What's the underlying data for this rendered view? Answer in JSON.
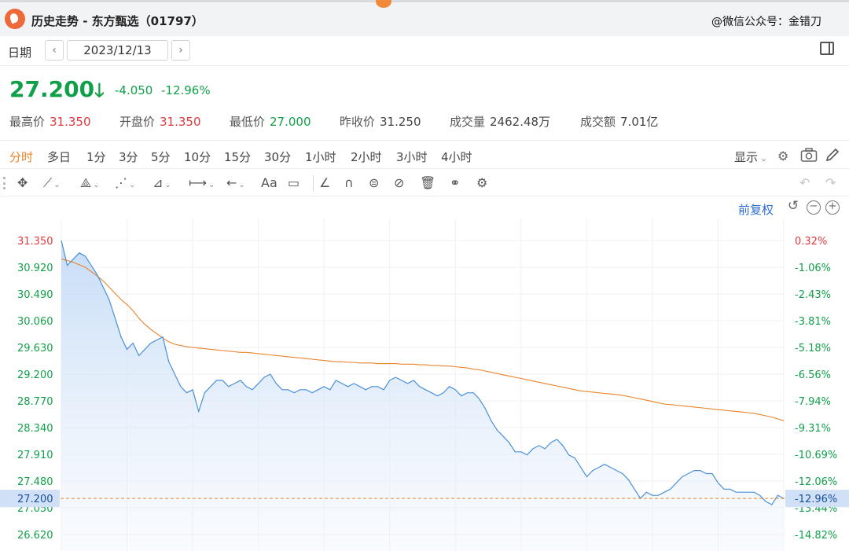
{
  "window": {
    "title": "历史走势 - 东方甄选（01797）",
    "watermark": "@微信公众号：金错刀"
  },
  "date_bar": {
    "label": "日期",
    "prev": "‹",
    "next": "›",
    "date": "2023/12/13"
  },
  "quote": {
    "price": "27.200",
    "arrow": "🡓",
    "change": "-4.050",
    "change_pct": "-12.96%",
    "stats": [
      {
        "label": "最高价",
        "value": "31.350",
        "tone": "up"
      },
      {
        "label": "开盘价",
        "value": "31.350",
        "tone": "up"
      },
      {
        "label": "最低价",
        "value": "27.000",
        "tone": "down"
      },
      {
        "label": "昨收价",
        "value": "31.250",
        "tone": "neutral"
      },
      {
        "label": "成交量",
        "value": "2462.48万",
        "tone": "neutral"
      },
      {
        "label": "成交额",
        "value": "7.01亿",
        "tone": "neutral"
      }
    ]
  },
  "periods": {
    "tabs": [
      "分时",
      "多日",
      "1分",
      "3分",
      "5分",
      "10分",
      "15分",
      "30分",
      "1小时",
      "2小时",
      "3小时",
      "4小时"
    ],
    "active": "分时",
    "show_label": "显示"
  },
  "chart_header": {
    "restore_label": "前复权"
  },
  "colors": {
    "up": "#e0393e",
    "down": "#11a04a",
    "price_line": "#4a90d9",
    "avg_line": "#e8842c",
    "current_price_tag": "#cfe0f7",
    "accent": "#e8842c",
    "link": "#2f6fd0"
  },
  "chart_data": {
    "type": "line",
    "title": "",
    "y_left_ticks": [
      "31.350",
      "30.920",
      "30.490",
      "30.060",
      "29.630",
      "29.200",
      "28.770",
      "28.340",
      "27.910",
      "27.480",
      "27.050",
      "26.620"
    ],
    "y_right_ticks": [
      "0.32%",
      "-1.06%",
      "-2.43%",
      "-3.81%",
      "-5.18%",
      "-6.56%",
      "-7.94%",
      "-9.31%",
      "-10.69%",
      "-12.06%",
      "-13.44%",
      "-14.82%"
    ],
    "ylim": [
      26.62,
      31.35
    ],
    "current_price": "27.200",
    "current_pct": "-12.96%",
    "grid": true,
    "series": [
      {
        "values": [
          31.35,
          30.95,
          31.05,
          31.15,
          31.1,
          30.95,
          30.8,
          30.6,
          30.4,
          30.1,
          29.8,
          29.6,
          29.7,
          29.5,
          29.6,
          29.7,
          29.75,
          29.8,
          29.4,
          29.2,
          29.0,
          28.9,
          28.95,
          28.6,
          28.9,
          29.0,
          29.1,
          29.1,
          29.0,
          29.05,
          29.1,
          29.0,
          28.95,
          29.05,
          29.15,
          29.2,
          29.05,
          28.95,
          28.95,
          28.9,
          28.95,
          28.95,
          28.9,
          28.95,
          29.0,
          28.95,
          29.1,
          29.05,
          29.0,
          29.05,
          29.0,
          28.95,
          29.0,
          29.0,
          28.95,
          29.1,
          29.15,
          29.1,
          29.05,
          29.1,
          29.0,
          28.95,
          28.9,
          28.85,
          28.9,
          29.0,
          28.95,
          28.85,
          28.9,
          28.9,
          28.8,
          28.65,
          28.45,
          28.3,
          28.2,
          28.1,
          27.95,
          27.95,
          27.9,
          28.0,
          28.05,
          28.0,
          28.1,
          28.15,
          28.05,
          27.9,
          27.85,
          27.7,
          27.55,
          27.65,
          27.7,
          27.75,
          27.7,
          27.65,
          27.6,
          27.5,
          27.35,
          27.2,
          27.3,
          27.25,
          27.25,
          27.3,
          27.35,
          27.45,
          27.55,
          27.6,
          27.65,
          27.65,
          27.6,
          27.6,
          27.45,
          27.35,
          27.35,
          27.3,
          27.3,
          27.3,
          27.3,
          27.25,
          27.15,
          27.1,
          27.25,
          27.2
        ],
        "color": "#4a90d9"
      },
      {
        "values": [
          31.05,
          31.03,
          31.0,
          30.96,
          30.92,
          30.85,
          30.78,
          30.7,
          30.6,
          30.5,
          30.4,
          30.32,
          30.22,
          30.1,
          30.0,
          29.92,
          29.85,
          29.78,
          29.72,
          29.68,
          29.66,
          29.64,
          29.63,
          29.62,
          29.61,
          29.6,
          29.59,
          29.58,
          29.57,
          29.56,
          29.55,
          29.55,
          29.54,
          29.53,
          29.52,
          29.51,
          29.5,
          29.49,
          29.48,
          29.47,
          29.46,
          29.45,
          29.44,
          29.43,
          29.42,
          29.41,
          29.4,
          29.4,
          29.39,
          29.39,
          29.38,
          29.38,
          29.38,
          29.37,
          29.37,
          29.37,
          29.37,
          29.36,
          29.36,
          29.36,
          29.35,
          29.35,
          29.34,
          29.34,
          29.33,
          29.33,
          29.32,
          29.31,
          29.3,
          29.28,
          29.27,
          29.25,
          29.23,
          29.21,
          29.19,
          29.17,
          29.15,
          29.13,
          29.11,
          29.09,
          29.07,
          29.05,
          29.03,
          29.01,
          28.99,
          28.97,
          28.95,
          28.93,
          28.92,
          28.91,
          28.9,
          28.89,
          28.88,
          28.87,
          28.86,
          28.84,
          28.82,
          28.8,
          28.78,
          28.76,
          28.74,
          28.72,
          28.71,
          28.7,
          28.69,
          28.68,
          28.67,
          28.66,
          28.65,
          28.64,
          28.63,
          28.62,
          28.61,
          28.6,
          28.59,
          28.58,
          28.57,
          28.55,
          28.53,
          28.51,
          28.48,
          28.45
        ],
        "color": "#e8842c"
      }
    ]
  }
}
